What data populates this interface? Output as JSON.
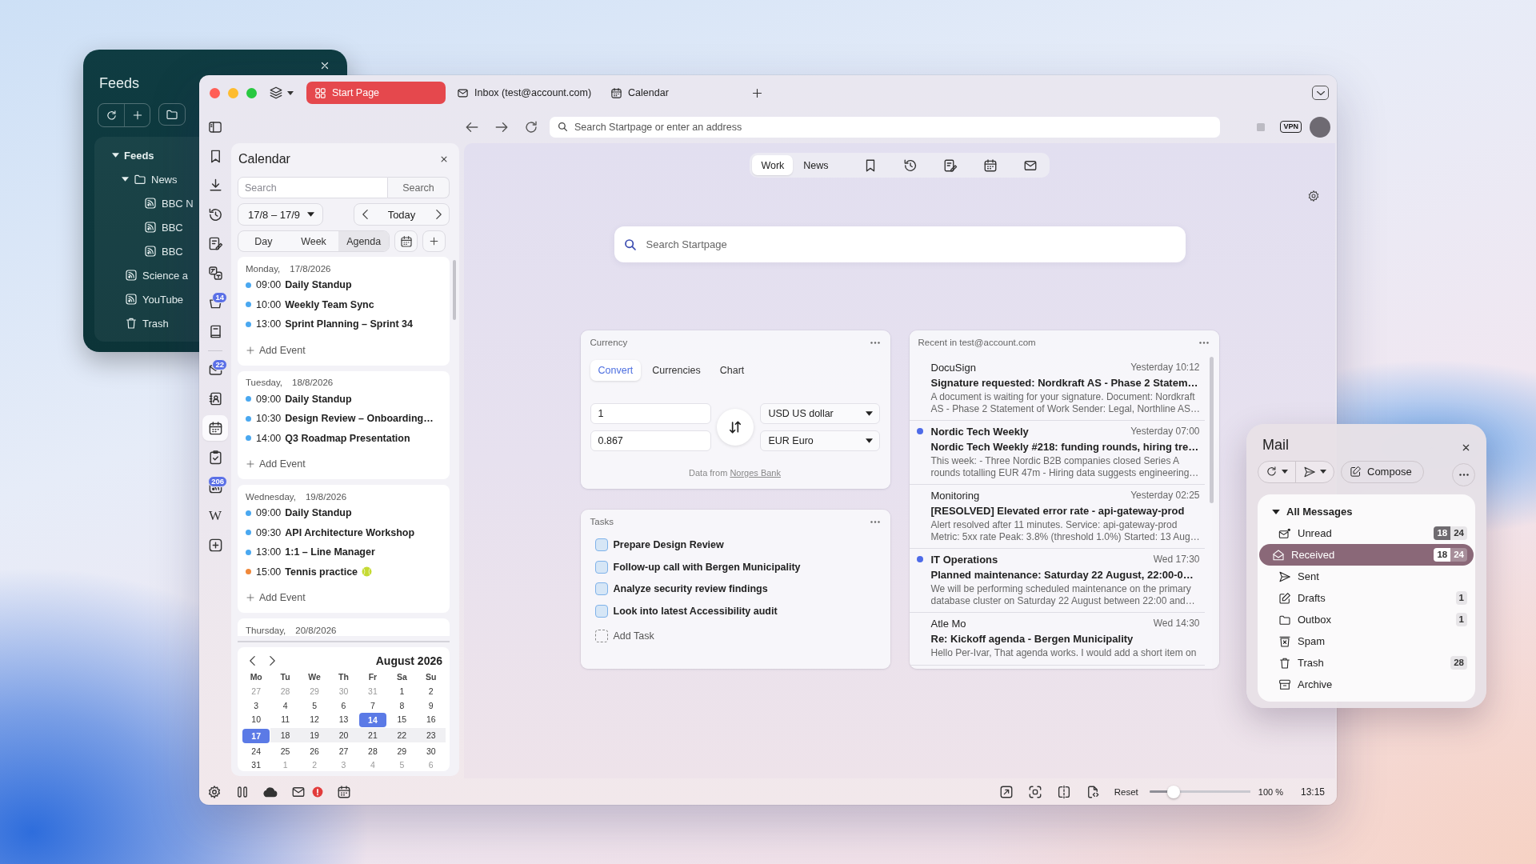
{
  "feeds_window": {
    "title": "Feeds",
    "tree": [
      {
        "label": "Feeds",
        "kind": "root",
        "expanded": true,
        "children": [
          {
            "label": "News",
            "kind": "folder",
            "expanded": true,
            "children": [
              {
                "label": "BBC N",
                "kind": "feed"
              },
              {
                "label": "BBC",
                "kind": "feed"
              },
              {
                "label": "BBC",
                "kind": "feed"
              }
            ]
          }
        ]
      },
      {
        "label": "Science a",
        "kind": "feed"
      },
      {
        "label": "YouTube",
        "kind": "feed"
      },
      {
        "label": "Trash",
        "kind": "trash"
      }
    ]
  },
  "browser": {
    "tabs": [
      {
        "label": "Start Page",
        "kind": "start",
        "selected": true
      },
      {
        "label": "Inbox (test@account.com)",
        "kind": "mail",
        "selected": false
      },
      {
        "label": "Calendar",
        "kind": "calendar",
        "selected": false
      }
    ],
    "address_bar": {
      "placeholder": "Search Startpage or enter an address"
    },
    "vpn_label": "VPN",
    "sidebar": {
      "groups": [
        [
          {
            "kind": "bookmarks",
            "selected": false
          },
          {
            "kind": "downloads",
            "selected": false
          },
          {
            "kind": "history",
            "selected": false
          },
          {
            "kind": "notes",
            "selected": false
          },
          {
            "kind": "translate",
            "selected": false
          },
          {
            "kind": "reading",
            "selected": false,
            "badge": "14"
          },
          {
            "kind": "reader",
            "selected": false
          }
        ],
        [
          {
            "kind": "mail",
            "selected": false,
            "badge": "22"
          },
          {
            "kind": "contacts",
            "selected": false
          },
          {
            "kind": "calendar",
            "selected": true
          },
          {
            "kind": "tasks",
            "selected": false
          },
          {
            "kind": "feeds",
            "selected": false,
            "badge": "206"
          },
          {
            "kind": "web",
            "selected": false,
            "label": "W"
          },
          {
            "kind": "add",
            "selected": false
          }
        ]
      ]
    },
    "calendar_panel": {
      "title": "Calendar",
      "search": {
        "placeholder": "Search",
        "button": "Search"
      },
      "range": "17/8 – 17/9",
      "today_label": "Today",
      "views": [
        {
          "label": "Day",
          "selected": false
        },
        {
          "label": "Week",
          "selected": false
        },
        {
          "label": "Agenda",
          "selected": true
        }
      ],
      "days": [
        {
          "weekday": "Monday,",
          "date": "17/8/2026",
          "events": [
            {
              "kind": "plain",
              "time": "09:00",
              "title": "Daily Standup",
              "color": "#4aa8f0"
            },
            {
              "kind": "plain",
              "time": "10:00",
              "title": "Weekly Team Sync",
              "color": "#4aa8f0"
            },
            {
              "kind": "plain",
              "time": "13:00",
              "title": "Sprint Planning – Sprint 34",
              "color": "#4aa8f0"
            }
          ],
          "add_label": "Add Event"
        },
        {
          "weekday": "Tuesday,",
          "date": "18/8/2026",
          "events": [
            {
              "kind": "plain",
              "time": "09:00",
              "title": "Daily Standup",
              "color": "#4aa8f0"
            },
            {
              "kind": "plain",
              "time": "10:30",
              "title": "Design Review – Onboarding…",
              "color": "#4aa8f0"
            },
            {
              "kind": "plain",
              "time": "14:00",
              "title": "Q3 Roadmap Presentation",
              "color": "#4aa8f0"
            }
          ],
          "add_label": "Add Event"
        },
        {
          "weekday": "Wednesday,",
          "date": "19/8/2026",
          "events": [
            {
              "kind": "plain",
              "time": "09:00",
              "title": "Daily Standup",
              "color": "#4aa8f0"
            },
            {
              "kind": "plain",
              "time": "09:30",
              "title": "API Architecture Workshop",
              "color": "#4aa8f0"
            },
            {
              "kind": "plain",
              "time": "13:00",
              "title": "1:1 – Line Manager",
              "color": "#4aa8f0"
            },
            {
              "kind": "tennis",
              "time": "15:00",
              "title": "Tennis practice",
              "color": "#f0883a"
            }
          ],
          "add_label": "Add Event"
        },
        {
          "weekday": "Thursday,",
          "date": "20/8/2026"
        }
      ],
      "mini_calendar": {
        "month": "August 2026",
        "weekdays": [
          "Mo",
          "Tu",
          "We",
          "Th",
          "Fr",
          "Sa",
          "Su"
        ],
        "weeks": [
          {
            "highlighted": false,
            "days": [
              {
                "day": "27",
                "muted": true,
                "selected": false
              },
              {
                "day": "28",
                "muted": true,
                "selected": false
              },
              {
                "day": "29",
                "muted": true,
                "selected": false
              },
              {
                "day": "30",
                "muted": true,
                "selected": false
              },
              {
                "day": "31",
                "muted": true,
                "selected": false
              },
              {
                "day": "1",
                "muted": false,
                "selected": false
              },
              {
                "day": "2",
                "muted": false,
                "selected": false
              }
            ]
          },
          {
            "highlighted": false,
            "days": [
              {
                "day": "3",
                "muted": false,
                "selected": false
              },
              {
                "day": "4",
                "muted": false,
                "selected": false
              },
              {
                "day": "5",
                "muted": false,
                "selected": false
              },
              {
                "day": "6",
                "muted": false,
                "selected": false
              },
              {
                "day": "7",
                "muted": false,
                "selected": false
              },
              {
                "day": "8",
                "muted": false,
                "selected": false
              },
              {
                "day": "9",
                "muted": false,
                "selected": false
              }
            ]
          },
          {
            "highlighted": false,
            "days": [
              {
                "day": "10",
                "muted": false,
                "selected": false
              },
              {
                "day": "11",
                "muted": false,
                "selected": false
              },
              {
                "day": "12",
                "muted": false,
                "selected": false
              },
              {
                "day": "13",
                "muted": false,
                "selected": false
              },
              {
                "day": "14",
                "muted": false,
                "selected": true
              },
              {
                "day": "15",
                "muted": false,
                "selected": false
              },
              {
                "day": "16",
                "muted": false,
                "selected": false
              }
            ]
          },
          {
            "highlighted": true,
            "days": [
              {
                "day": "17",
                "muted": false,
                "selected": true
              },
              {
                "day": "18",
                "muted": false,
                "selected": false
              },
              {
                "day": "19",
                "muted": false,
                "selected": false
              },
              {
                "day": "20",
                "muted": false,
                "selected": false
              },
              {
                "day": "21",
                "muted": false,
                "selected": false
              },
              {
                "day": "22",
                "muted": false,
                "selected": false
              },
              {
                "day": "23",
                "muted": false,
                "selected": false
              }
            ]
          },
          {
            "highlighted": false,
            "days": [
              {
                "day": "24",
                "muted": false,
                "selected": false
              },
              {
                "day": "25",
                "muted": false,
                "selected": false
              },
              {
                "day": "26",
                "muted": false,
                "selected": false
              },
              {
                "day": "27",
                "muted": false,
                "selected": false
              },
              {
                "day": "28",
                "muted": false,
                "selected": false
              },
              {
                "day": "29",
                "muted": false,
                "selected": false
              },
              {
                "day": "30",
                "muted": false,
                "selected": false
              }
            ]
          },
          {
            "highlighted": false,
            "days": [
              {
                "day": "31",
                "muted": false,
                "selected": false
              },
              {
                "day": "1",
                "muted": true,
                "selected": false
              },
              {
                "day": "2",
                "muted": true,
                "selected": false
              },
              {
                "day": "3",
                "muted": true,
                "selected": false
              },
              {
                "day": "4",
                "muted": true,
                "selected": false
              },
              {
                "day": "5",
                "muted": true,
                "selected": false
              },
              {
                "day": "6",
                "muted": true,
                "selected": false
              }
            ]
          }
        ]
      }
    },
    "start_page": {
      "switcher": [
        {
          "label": "Work",
          "selected": true
        },
        {
          "label": "News",
          "selected": false
        }
      ],
      "shortcuts": [
        {
          "kind": "bookmarks"
        },
        {
          "kind": "history"
        },
        {
          "kind": "notes"
        },
        {
          "kind": "calendar"
        },
        {
          "kind": "mail"
        }
      ],
      "search": {
        "placeholder": "Search Startpage"
      },
      "currency": {
        "title": "Currency",
        "tabs": [
          {
            "label": "Convert",
            "selected": true
          },
          {
            "label": "Currencies",
            "selected": false
          },
          {
            "label": "Chart",
            "selected": false
          }
        ],
        "from_amount": "1",
        "to_amount": "0.867",
        "from_currency": "USD US dollar",
        "to_currency": "EUR Euro",
        "source": {
          "text": "Data from",
          "link": "Norges Bank"
        }
      },
      "tasks": {
        "title": "Tasks",
        "items": [
          {
            "label": "Prepare Design Review",
            "checked": false
          },
          {
            "label": "Follow-up call with Bergen Municipality",
            "checked": false
          },
          {
            "label": "Analyze security review findings",
            "checked": false
          },
          {
            "label": "Look into latest Accessibility audit",
            "checked": false
          }
        ],
        "add_label": "Add Task"
      },
      "recent_mail": {
        "title": "Recent in test@account.com",
        "messages": [
          {
            "sender": "DocuSign",
            "time": "Yesterday 10:12",
            "subject": "Signature requested: Nordkraft AS - Phase 2 Statem…",
            "preview": [
              "A document is waiting for your signature. Document: Nordkraft",
              "AS - Phase 2 Statement of Work Sender: Legal, Northline AS…"
            ],
            "unread": false
          },
          {
            "sender": "Nordic Tech Weekly",
            "time": "Yesterday 07:00",
            "subject": "Nordic Tech Weekly #218: funding rounds, hiring tre…",
            "preview": [
              "This week: - Three Nordic B2B companies closed Series A",
              "rounds totalling EUR 47m - Hiring data suggests engineering…"
            ],
            "unread": true
          },
          {
            "sender": "Monitoring",
            "time": "Yesterday 02:25",
            "subject": "[RESOLVED] Elevated error rate - api-gateway-prod",
            "preview": [
              "Alert resolved after 11 minutes. Service: api-gateway-prod",
              "Metric: 5xx rate Peak: 3.8% (threshold 1.0%) Started: 13 Aug…"
            ],
            "unread": false
          },
          {
            "sender": "IT Operations",
            "time": "Wed 17:30",
            "subject": "Planned maintenance: Saturday 22 August, 22:00-0…",
            "preview": [
              "We will be performing scheduled maintenance on the primary",
              "database cluster on Saturday 22 August between 22:00 and…"
            ],
            "unread": true
          },
          {
            "sender": "Atle Mo",
            "time": "Wed 14:30",
            "subject": "Re: Kickoff agenda - Bergen Municipality",
            "preview": [
              "Hello Per-Ivar, That agenda works. I would add a short item on"
            ],
            "unread": false
          }
        ]
      }
    },
    "status_bar": {
      "left_buttons": [
        {
          "kind": "settings",
          "alert": false
        },
        {
          "kind": "pause",
          "alert": false
        },
        {
          "kind": "sync",
          "alert": false
        },
        {
          "kind": "mail",
          "alert": true
        },
        {
          "kind": "calendar",
          "alert": false
        }
      ],
      "right_buttons": [
        {
          "kind": "fullscreen"
        },
        {
          "kind": "capture"
        },
        {
          "kind": "tiling"
        },
        {
          "kind": "page_actions"
        }
      ],
      "zoom_reset": "Reset",
      "zoom": {
        "level": 0.2
      },
      "zoom_reading": "100 %",
      "clock": "13:15"
    }
  },
  "mail_window": {
    "title": "Mail",
    "compose_label": "Compose",
    "tree": [
      {
        "label": "All Messages",
        "selected": false,
        "expanded": true,
        "children": [
          {
            "label": "Unread",
            "kind": "unread",
            "selected": false,
            "counts": [
              "18",
              "24"
            ]
          },
          {
            "label": "Received",
            "kind": "received",
            "selected": true,
            "counts": [
              "18",
              "24"
            ]
          },
          {
            "label": "Sent",
            "kind": "sent",
            "selected": false
          },
          {
            "label": "Drafts",
            "kind": "drafts",
            "selected": false,
            "counts": [
              "1"
            ]
          },
          {
            "label": "Outbox",
            "kind": "outbox",
            "selected": false,
            "counts": [
              "1"
            ]
          },
          {
            "label": "Spam",
            "kind": "spam",
            "selected": false
          },
          {
            "label": "Trash",
            "kind": "trash",
            "selected": false,
            "counts": [
              "28"
            ]
          },
          {
            "label": "Archive",
            "kind": "archive",
            "selected": false
          }
        ]
      }
    ]
  }
}
